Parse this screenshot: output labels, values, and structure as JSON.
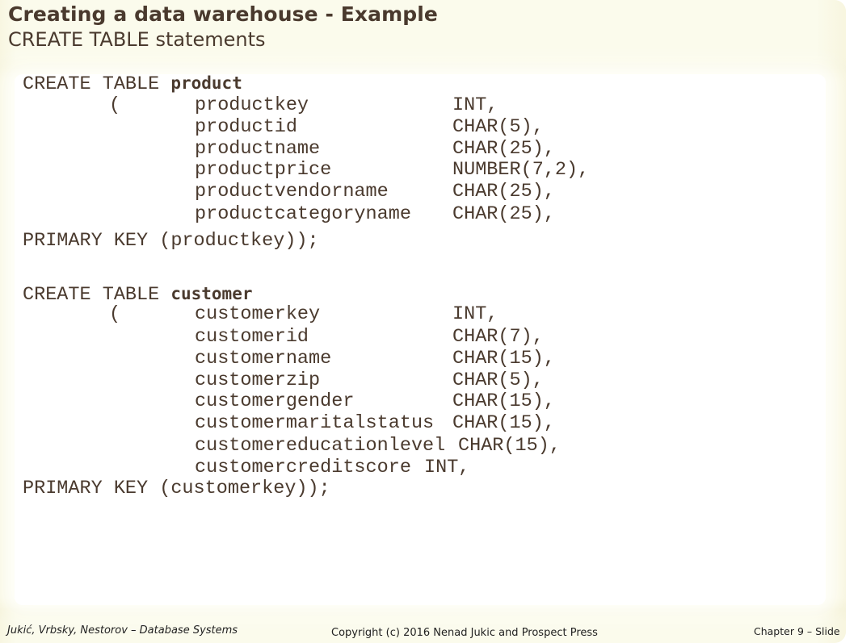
{
  "slide": {
    "title": "Creating a data warehouse - Example",
    "subtitle": "CREATE TABLE statements",
    "tables": [
      {
        "keyword": "CREATE TABLE",
        "name": "product",
        "open_paren": "(",
        "columns": [
          {
            "name": "productkey",
            "type": "INT,"
          },
          {
            "name": "productid",
            "type": "CHAR(5),"
          },
          {
            "name": "productname",
            "type": "CHAR(25),"
          },
          {
            "name": "productprice",
            "type": "NUMBER(7,2),"
          },
          {
            "name": "productvendorname",
            "type": "CHAR(25),"
          },
          {
            "name": "productcategoryname",
            "type": "CHAR(25),"
          }
        ],
        "primary_key": "PRIMARY KEY (productkey));"
      },
      {
        "keyword": "CREATE TABLE",
        "name": "customer",
        "open_paren": "(",
        "columns": [
          {
            "name": "customerkey",
            "type": "INT,"
          },
          {
            "name": "customerid",
            "type": "CHAR(7),"
          },
          {
            "name": "customername",
            "type": "CHAR(15),"
          },
          {
            "name": "customerzip",
            "type": "CHAR(5),"
          },
          {
            "name": "customergender",
            "type": "CHAR(15),"
          },
          {
            "name": "customermaritalstatus",
            "type": "CHAR(15),"
          },
          {
            "name": "customereducationlevel",
            "type": "CHAR(15),"
          },
          {
            "name": "customercreditscore",
            "type": "INT,"
          }
        ],
        "primary_key": "PRIMARY KEY (customerkey));"
      }
    ]
  },
  "footer": {
    "authors": "Jukić, Vrbsky, Nestorov – Database Systems",
    "copyright": "Copyright (c) 2016 Nenad Jukic and Prospect Press",
    "chapter": "Chapter 9 – Slide"
  },
  "colors": {
    "text": "#4a3a2e",
    "background": "#fbfbec",
    "panel": "#ffffff"
  }
}
